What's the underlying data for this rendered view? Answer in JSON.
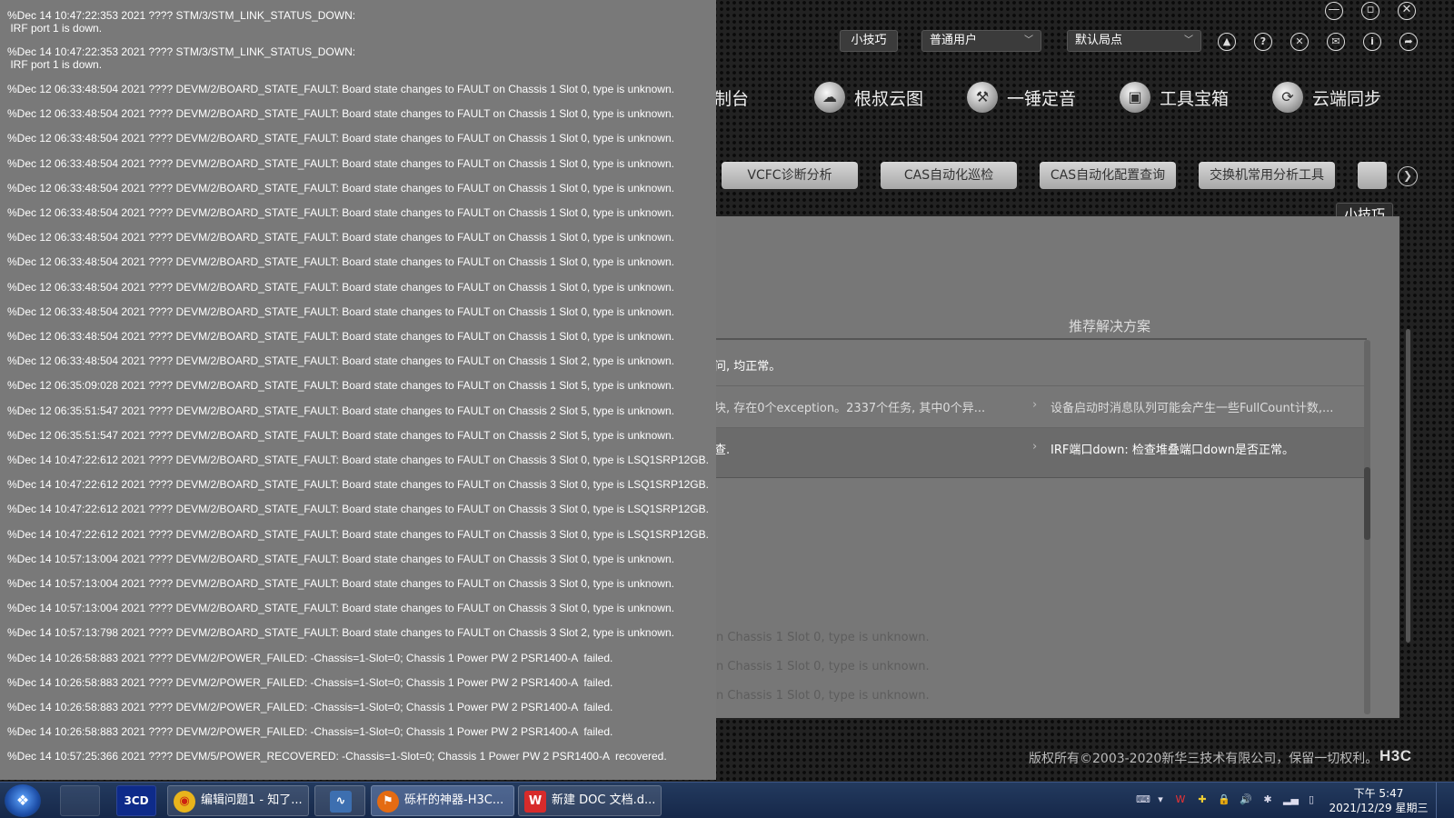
{
  "app": {
    "top_bar": {
      "tips_button": "小技巧",
      "user_select": "普通用户",
      "site_select": "默认局点"
    },
    "nav": [
      {
        "label": "制台",
        "icon": "console-icon"
      },
      {
        "label": "根叔云图",
        "icon": "cloud-map-icon"
      },
      {
        "label": "一锤定音",
        "icon": "hammer-icon"
      },
      {
        "label": "工具宝箱",
        "icon": "toolbox-icon"
      },
      {
        "label": "云端同步",
        "icon": "cloud-sync-icon"
      }
    ],
    "tools": [
      "VCFC诊断分析",
      "CAS自动化巡检",
      "CAS自动化配置查询",
      "交换机常用分析工具",
      ""
    ],
    "tips_badge": "小技巧",
    "panel": {
      "heading": "推荐解决方案",
      "rows": [
        {
          "left": "问, 均正常。",
          "right": ""
        },
        {
          "left": "块, 存在0个exception。2337个任务, 其中0个异...",
          "right": "设备启动时消息队列可能会产生一些FullCount计数,..."
        },
        {
          "left": "查.",
          "right": "IRF端口down: 检查堆叠端口down是否正常。"
        }
      ],
      "ghost_lines": [
        "n Chassis 1 Slot 0, type is unknown.",
        "n Chassis 1 Slot 0, type is unknown.",
        "n Chassis 1 Slot 0, type is unknown."
      ]
    },
    "copyright": "版权所有©2003-2020新华三技术有限公司，保留一切权利。",
    "logo": "H3C"
  },
  "log_lines": [
    "%Dec 14 10:47:22:353 2021 ???? STM/3/STM_LINK_STATUS_DOWN:",
    " IRF port 1 is down.",
    "%Dec 14 10:47:22:353 2021 ???? STM/3/STM_LINK_STATUS_DOWN:",
    " IRF port 1 is down.",
    "%Dec 12 06:33:48:504 2021 ???? DEVM/2/BOARD_STATE_FAULT: Board state changes to FAULT on Chassis 1 Slot 0, type is unknown.",
    "%Dec 12 06:33:48:504 2021 ???? DEVM/2/BOARD_STATE_FAULT: Board state changes to FAULT on Chassis 1 Slot 0, type is unknown.",
    "%Dec 12 06:33:48:504 2021 ???? DEVM/2/BOARD_STATE_FAULT: Board state changes to FAULT on Chassis 1 Slot 0, type is unknown.",
    "%Dec 12 06:33:48:504 2021 ???? DEVM/2/BOARD_STATE_FAULT: Board state changes to FAULT on Chassis 1 Slot 0, type is unknown.",
    "%Dec 12 06:33:48:504 2021 ???? DEVM/2/BOARD_STATE_FAULT: Board state changes to FAULT on Chassis 1 Slot 0, type is unknown.",
    "%Dec 12 06:33:48:504 2021 ???? DEVM/2/BOARD_STATE_FAULT: Board state changes to FAULT on Chassis 1 Slot 0, type is unknown.",
    "%Dec 12 06:33:48:504 2021 ???? DEVM/2/BOARD_STATE_FAULT: Board state changes to FAULT on Chassis 1 Slot 0, type is unknown.",
    "%Dec 12 06:33:48:504 2021 ???? DEVM/2/BOARD_STATE_FAULT: Board state changes to FAULT on Chassis 1 Slot 0, type is unknown.",
    "%Dec 12 06:33:48:504 2021 ???? DEVM/2/BOARD_STATE_FAULT: Board state changes to FAULT on Chassis 1 Slot 0, type is unknown.",
    "%Dec 12 06:33:48:504 2021 ???? DEVM/2/BOARD_STATE_FAULT: Board state changes to FAULT on Chassis 1 Slot 0, type is unknown.",
    "%Dec 12 06:33:48:504 2021 ???? DEVM/2/BOARD_STATE_FAULT: Board state changes to FAULT on Chassis 1 Slot 0, type is unknown.",
    "%Dec 12 06:33:48:504 2021 ???? DEVM/2/BOARD_STATE_FAULT: Board state changes to FAULT on Chassis 1 Slot 2, type is unknown.",
    "%Dec 12 06:35:09:028 2021 ???? DEVM/2/BOARD_STATE_FAULT: Board state changes to FAULT on Chassis 1 Slot 5, type is unknown.",
    "%Dec 12 06:35:51:547 2021 ???? DEVM/2/BOARD_STATE_FAULT: Board state changes to FAULT on Chassis 2 Slot 5, type is unknown.",
    "%Dec 12 06:35:51:547 2021 ???? DEVM/2/BOARD_STATE_FAULT: Board state changes to FAULT on Chassis 2 Slot 5, type is unknown.",
    "%Dec 14 10:47:22:612 2021 ???? DEVM/2/BOARD_STATE_FAULT: Board state changes to FAULT on Chassis 3 Slot 0, type is LSQ1SRP12GB.",
    "%Dec 14 10:47:22:612 2021 ???? DEVM/2/BOARD_STATE_FAULT: Board state changes to FAULT on Chassis 3 Slot 0, type is LSQ1SRP12GB.",
    "%Dec 14 10:47:22:612 2021 ???? DEVM/2/BOARD_STATE_FAULT: Board state changes to FAULT on Chassis 3 Slot 0, type is LSQ1SRP12GB.",
    "%Dec 14 10:47:22:612 2021 ???? DEVM/2/BOARD_STATE_FAULT: Board state changes to FAULT on Chassis 3 Slot 0, type is LSQ1SRP12GB.",
    "%Dec 14 10:57:13:004 2021 ???? DEVM/2/BOARD_STATE_FAULT: Board state changes to FAULT on Chassis 3 Slot 0, type is unknown.",
    "%Dec 14 10:57:13:004 2021 ???? DEVM/2/BOARD_STATE_FAULT: Board state changes to FAULT on Chassis 3 Slot 0, type is unknown.",
    "%Dec 14 10:57:13:004 2021 ???? DEVM/2/BOARD_STATE_FAULT: Board state changes to FAULT on Chassis 3 Slot 0, type is unknown.",
    "%Dec 14 10:57:13:798 2021 ???? DEVM/2/BOARD_STATE_FAULT: Board state changes to FAULT on Chassis 3 Slot 2, type is unknown.",
    "%Dec 14 10:26:58:883 2021 ???? DEVM/2/POWER_FAILED: -Chassis=1-Slot=0; Chassis 1 Power PW 2 PSR1400-A  failed.",
    "%Dec 14 10:26:58:883 2021 ???? DEVM/2/POWER_FAILED: -Chassis=1-Slot=0; Chassis 1 Power PW 2 PSR1400-A  failed.",
    "%Dec 14 10:26:58:883 2021 ???? DEVM/2/POWER_FAILED: -Chassis=1-Slot=0; Chassis 1 Power PW 2 PSR1400-A  failed.",
    "%Dec 14 10:26:58:883 2021 ???? DEVM/2/POWER_FAILED: -Chassis=1-Slot=0; Chassis 1 Power PW 2 PSR1400-A  failed.",
    "%Dec 14 10:57:25:366 2021 ???? DEVM/5/POWER_RECOVERED: -Chassis=1-Slot=0; Chassis 1 Power PW 2 PSR1400-A  recovered."
  ],
  "taskbar": {
    "pinned": [
      "",
      "3CD",
      ""
    ],
    "tasks": [
      {
        "label": "编辑问题1 - 知了...",
        "icon": "chrome-icon",
        "color": "#e9b41c"
      },
      {
        "label": "",
        "icon": "signal-app-icon",
        "color": "#3d6fb0"
      },
      {
        "label": "砾杆的神器-H3C...",
        "icon": "h3c-tool-icon",
        "color": "#e46b12"
      },
      {
        "label": "新建 DOC 文档.d...",
        "icon": "wps-icon",
        "color": "#d72b2b"
      }
    ],
    "clock_time": "下午 5:47",
    "clock_date": "2021/12/29 星期三"
  }
}
